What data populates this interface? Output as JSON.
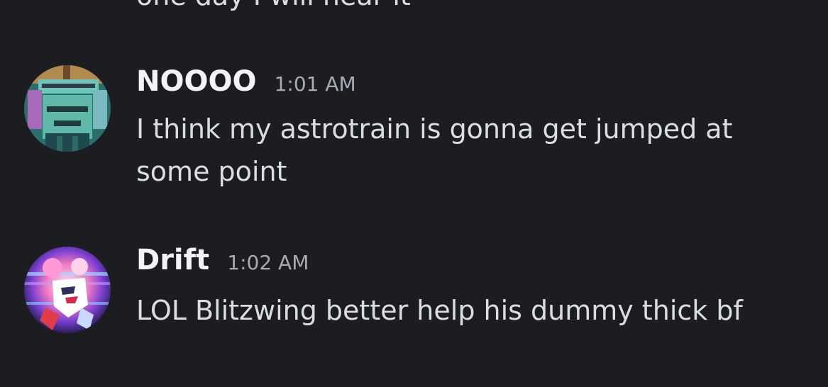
{
  "partial_message": "one day I will hear it",
  "messages": [
    {
      "username": "NOOOO",
      "timestamp": "1:01 AM",
      "content": "I think my astrotrain is gonna get jumped at some point",
      "avatar": "robot-avatar-icon"
    },
    {
      "username": "Drift",
      "timestamp": "1:02 AM",
      "content": "LOL Blitzwing better help his dummy thick bf",
      "avatar": "drift-avatar-icon"
    }
  ],
  "colors": {
    "background": "#1c1d21",
    "username": "#f2f3f5",
    "message_text": "#dbdee1",
    "timestamp": "#a8abb3"
  }
}
